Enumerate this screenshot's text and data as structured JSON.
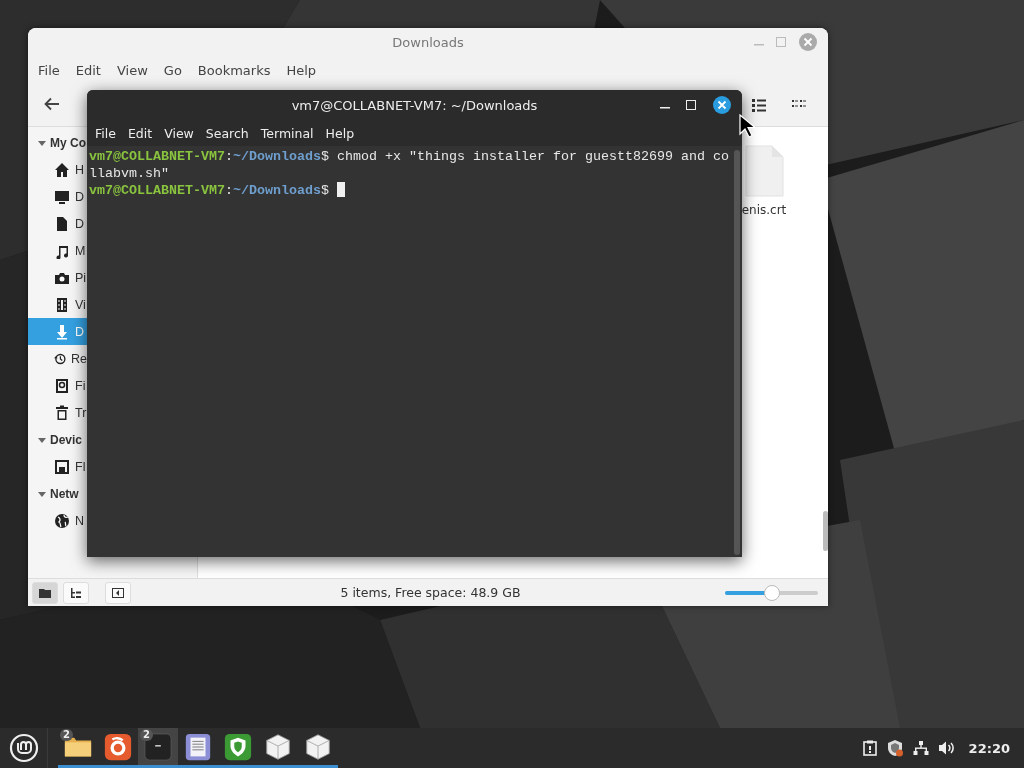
{
  "file_manager": {
    "title": "Downloads",
    "menu": [
      "File",
      "Edit",
      "View",
      "Go",
      "Bookmarks",
      "Help"
    ],
    "view_buttons": [
      {
        "kind": "list",
        "selected": false
      },
      {
        "kind": "compact",
        "selected": false
      }
    ],
    "sidebar": [
      {
        "kind": "header",
        "label": "My Co",
        "expanded": true
      },
      {
        "kind": "home",
        "label": "H",
        "selected": false
      },
      {
        "kind": "desktop",
        "label": "D",
        "selected": false
      },
      {
        "kind": "document",
        "label": "D",
        "selected": false
      },
      {
        "kind": "music",
        "label": "M",
        "selected": false
      },
      {
        "kind": "camera",
        "label": "Pi",
        "selected": false
      },
      {
        "kind": "film",
        "label": "Vi",
        "selected": false
      },
      {
        "kind": "download",
        "label": "D",
        "selected": true
      },
      {
        "kind": "recent",
        "label": "Re",
        "selected": false
      },
      {
        "kind": "drive",
        "label": "Fi",
        "selected": false
      },
      {
        "kind": "trash",
        "label": "Tr",
        "selected": false
      },
      {
        "kind": "header",
        "label": "Devic",
        "expanded": true
      },
      {
        "kind": "floppy",
        "label": "Fl",
        "selected": false
      },
      {
        "kind": "header",
        "label": "Netw",
        "expanded": true
      },
      {
        "kind": "globe",
        "label": "N",
        "selected": false
      }
    ],
    "files": [
      {
        "name": "enis.crt"
      }
    ],
    "pane_buttons": [
      {
        "kind": "places",
        "selected": true
      },
      {
        "kind": "tree",
        "selected": false
      },
      {
        "kind": "sidebar",
        "selected": false
      }
    ],
    "status": "5 items, Free space: 48.9 GB",
    "zoom": {
      "level": 0.5
    }
  },
  "terminal": {
    "title": "vm7@COLLABNET-VM7: ~/Downloads",
    "menu": [
      "File",
      "Edit",
      "View",
      "Search",
      "Terminal",
      "Help"
    ],
    "lines": [
      {
        "user": "vm7@COLLABNET-VM7",
        "separator": ":",
        "path": "~/Downloads",
        "symbol": "$",
        "command": "chmod +x \"things installer for guestt82699 and collabvm.sh\"",
        "cursor": false
      },
      {
        "user": "vm7@COLLABNET-VM7",
        "separator": ":",
        "path": "~/Downloads",
        "symbol": "$",
        "cursor": true
      }
    ]
  },
  "taskbar": {
    "apps": [
      {
        "kind": "folder",
        "badge": "2",
        "selected": false
      },
      {
        "kind": "browser",
        "selected": false
      },
      {
        "kind": "terminal",
        "badge": "2",
        "selected": true
      },
      {
        "kind": "editor",
        "selected": false
      },
      {
        "kind": "shield",
        "selected": false
      },
      {
        "kind": "cube",
        "selected": false
      },
      {
        "kind": "cube",
        "selected": false
      }
    ],
    "clock": "22:20"
  }
}
